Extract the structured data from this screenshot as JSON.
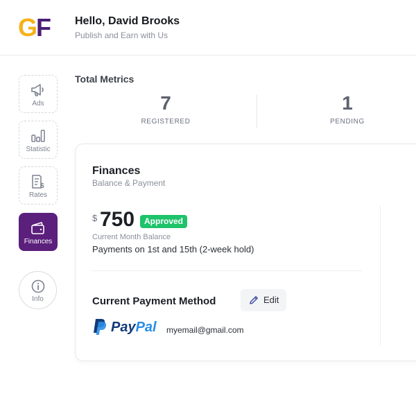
{
  "header": {
    "logo_g": "G",
    "logo_f": "F",
    "greeting": "Hello, David Brooks",
    "tagline": "Publish and Earn with Us"
  },
  "sidebar": {
    "items": [
      {
        "label": "Ads",
        "icon": "megaphone-icon",
        "active": false
      },
      {
        "label": "Statistic",
        "icon": "bar-chart-icon",
        "active": false
      },
      {
        "label": "Rates",
        "icon": "receipt-dollar-icon",
        "active": false
      },
      {
        "label": "Finances",
        "icon": "wallet-icon",
        "active": true
      }
    ],
    "info": {
      "label": "Info",
      "icon": "info-icon"
    }
  },
  "metrics": {
    "title": "Total Metrics",
    "items": [
      {
        "value": "7",
        "caption": "REGISTERED"
      },
      {
        "value": "1",
        "caption": "PENDING"
      }
    ]
  },
  "finances": {
    "title": "Finances",
    "subtitle": "Balance & Payment",
    "currency": "$",
    "amount": "750",
    "status": "Approved",
    "balance_label": "Current Month Balance",
    "payment_note": "Payments on 1st and 15th (2-week hold)",
    "payment_method_title": "Current Payment Method",
    "edit_label": "Edit",
    "paypal_pay": "Pay",
    "paypal_pal": "Pal",
    "email": "myemail@gmail.com"
  },
  "colors": {
    "brand_purple": "#5b1f7c",
    "logo_yellow": "#f5b21a",
    "approved_green": "#1ec36a",
    "paypal_dark": "#123a7a",
    "paypal_light": "#2a8ee6"
  }
}
